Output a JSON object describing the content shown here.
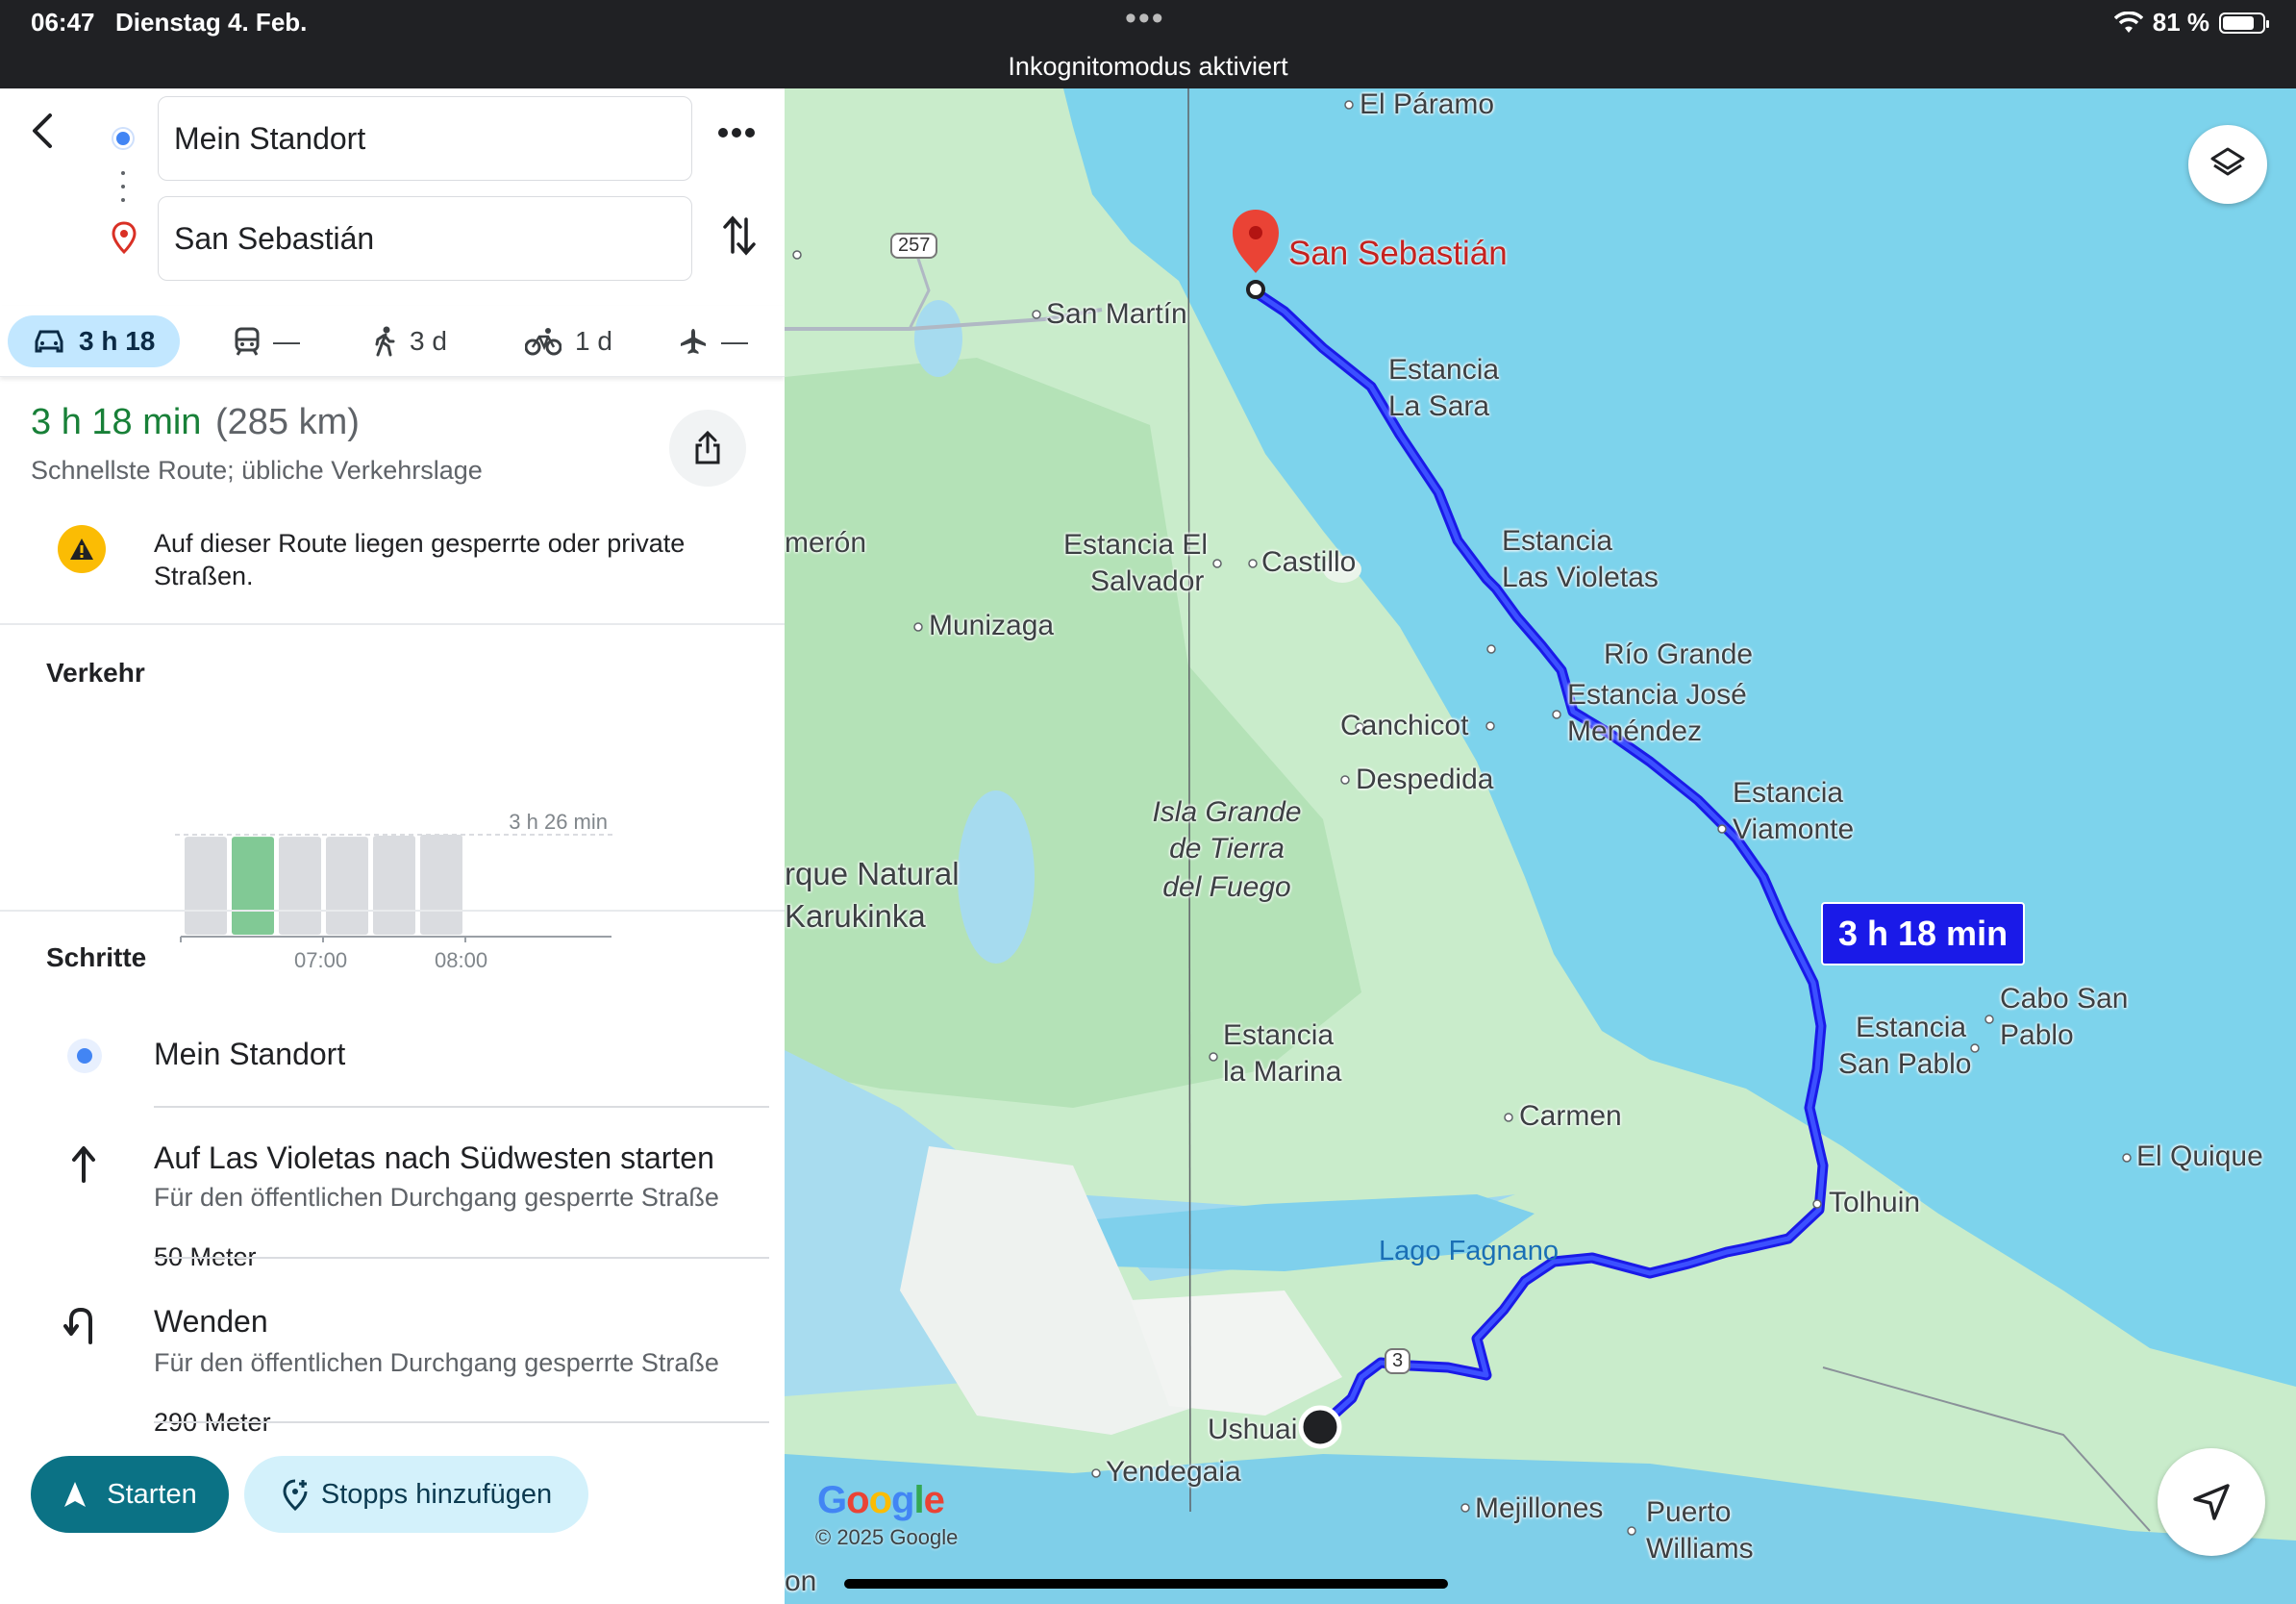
{
  "status_bar": {
    "time": "06:47",
    "date": "Dienstag 4. Feb.",
    "banner": "Inkognitomodus aktiviert",
    "battery": "81 %",
    "battery_level": 0.81
  },
  "directions": {
    "origin": "Mein Standort",
    "destination": "San Sebastián"
  },
  "modes": [
    {
      "name": "car",
      "label": "3 h 18",
      "icon": "car-icon",
      "active": true
    },
    {
      "name": "transit",
      "label": "—",
      "icon": "train-icon"
    },
    {
      "name": "walk",
      "label": "3 d",
      "icon": "walk-icon"
    },
    {
      "name": "bike",
      "label": "1 d",
      "icon": "bike-icon"
    },
    {
      "name": "flight",
      "label": "—",
      "icon": "airplane-icon"
    }
  ],
  "summary": {
    "duration": "3 h 18 min",
    "distance": "(285 km)",
    "subtitle": "Schnellste Route; übliche Verkehrslage",
    "warning": "Auf dieser Route liegen gesperrte oder private Straßen."
  },
  "traffic": {
    "title": "Verkehr",
    "max_label": "3 h 26 min",
    "ticks": [
      "07:00",
      "08:00"
    ],
    "bars": [
      {
        "value": 0.98,
        "active": false
      },
      {
        "value": 0.98,
        "active": true
      },
      {
        "value": 0.98,
        "active": false
      },
      {
        "value": 0.98,
        "active": false
      },
      {
        "value": 0.99,
        "active": false
      },
      {
        "value": 1.0,
        "active": false
      }
    ]
  },
  "steps": {
    "title": "Schritte",
    "items": [
      {
        "title": "Mein Standort"
      },
      {
        "title": "Auf Las Violetas nach Südwesten starten",
        "sub": "Für den öffentlichen Durchgang gesperrte Straße",
        "dist": "50 Meter"
      },
      {
        "title": "Wenden",
        "sub": "Für den öffentlichen Durchgang gesperrte Straße",
        "dist": "290 Meter"
      }
    ]
  },
  "buttons": {
    "start": "Starten",
    "add_stops": "Stopps hinzufügen"
  },
  "map": {
    "route_time": "3 h 18 min",
    "destination_label": "San Sebastián",
    "copyright": "© 2025 Google",
    "logo": "Google",
    "route_shield_257": "257",
    "route_shield_3": "3",
    "places": {
      "el_paramo": "El Páramo",
      "san_martin": "San Martín",
      "estancia_la_sara_1": "Estancia",
      "estancia_la_sara_2": "La Sara",
      "meron": "merón",
      "estancia_el_salvador_1": "Estancia El",
      "estancia_el_salvador_2": "Salvador",
      "castillo": "Castillo",
      "estancia_las_violetas_1": "Estancia",
      "estancia_las_violetas_2": "Las Violetas",
      "munizaga": "Munizaga",
      "rio_grande": "Río Grande",
      "estancia_jose_1": "Estancia José",
      "estancia_jose_2": "Menéndez",
      "canchicot": "Canchicot",
      "despedida": "Despedida",
      "isla_1": "Isla Grande",
      "isla_2": "de Tierra",
      "isla_3": "del Fuego",
      "estancia_viamonte_1": "Estancia",
      "estancia_viamonte_2": "Viamonte",
      "parque_1": "rque Natural",
      "parque_2": "Karukinka",
      "cabo_1": "Cabo San",
      "cabo_2": "Pablo",
      "estancia_sp_1": "Estancia",
      "estancia_sp_2": "San Pablo",
      "estancia_marina_1": "Estancia",
      "estancia_marina_2": "la Marina",
      "carmen": "Carmen",
      "el_quique": "El Quique",
      "tolhuin": "Tolhuin",
      "lago_fagnano": "Lago Fagnano",
      "ushuaia": "Ushuai",
      "yendegaia": "Yendegaia",
      "mejillones": "Mejillones",
      "puerto_1": "Puerto",
      "puerto_2": "Williams",
      "on": "on"
    }
  }
}
